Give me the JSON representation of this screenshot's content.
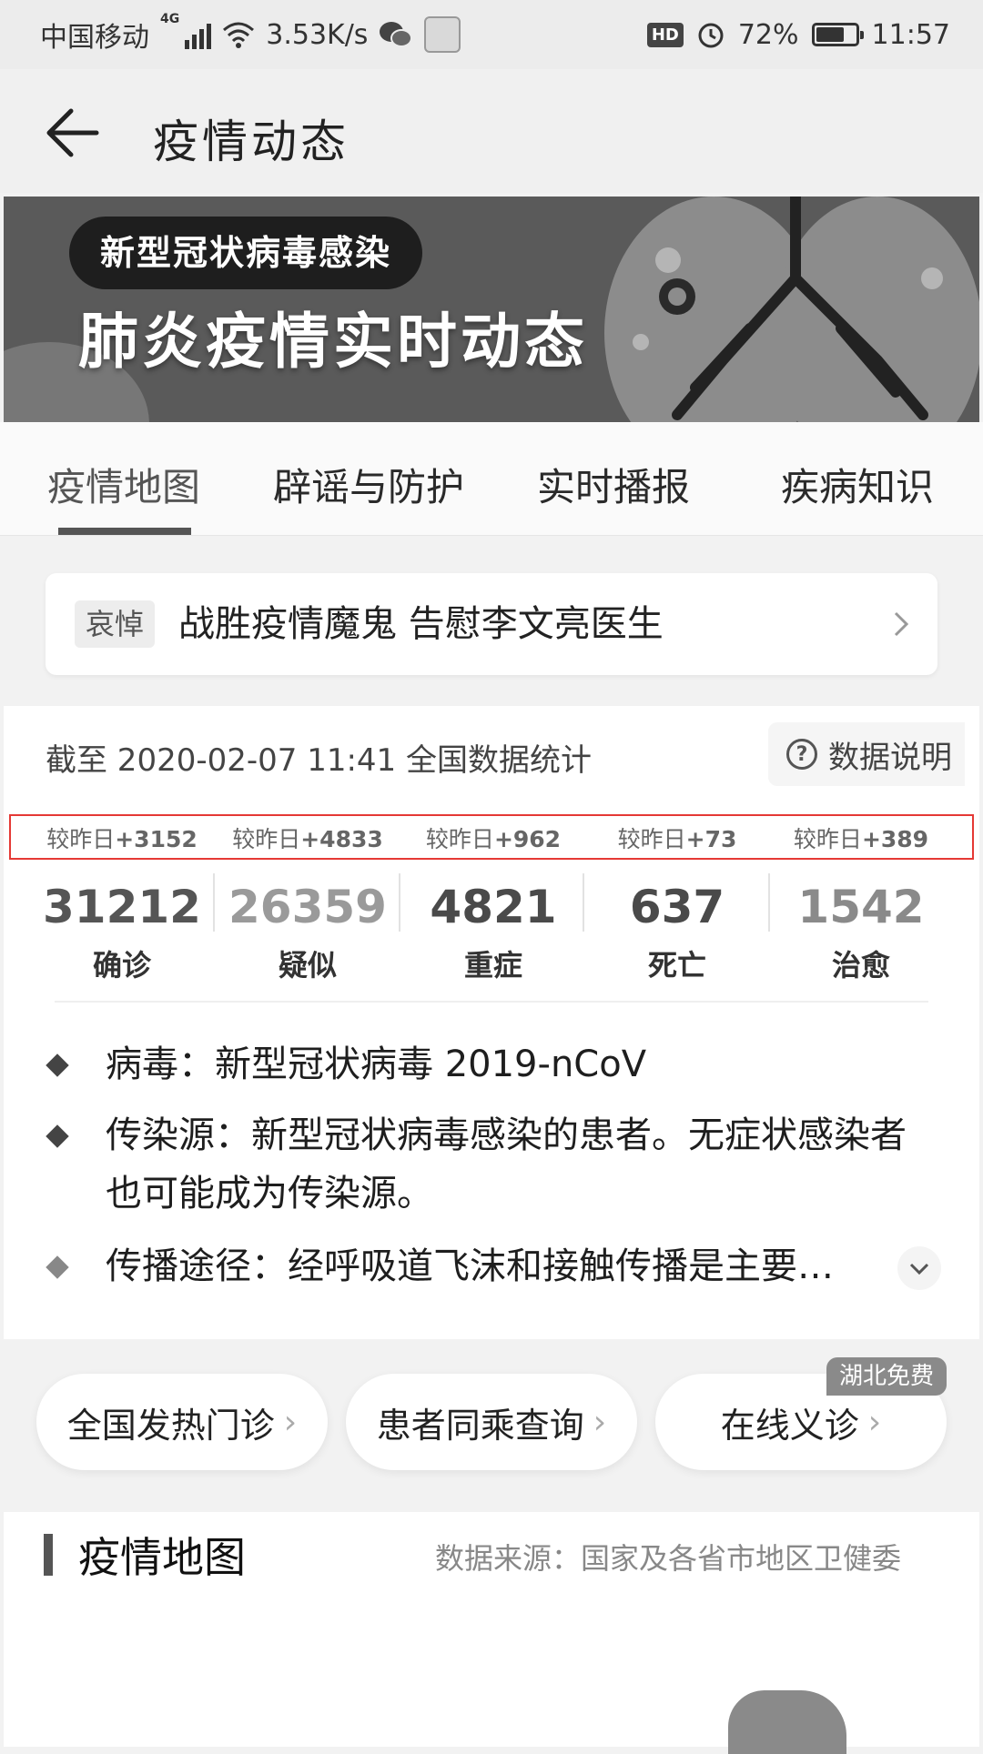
{
  "status_bar": {
    "carrier": "中国移动",
    "net_type": "4G",
    "speed": "3.53K/s",
    "hd_label": "HD",
    "battery": "72%",
    "battery_level": 0.72,
    "time": "11:57",
    "icons": [
      "signal-icon",
      "wifi-icon",
      "wechat-icon",
      "app-icon",
      "alarm-icon",
      "battery-icon"
    ]
  },
  "header": {
    "title": "疫情动态"
  },
  "banner": {
    "pill": "新型冠状病毒感染",
    "title": "肺炎疫情实时动态"
  },
  "tabs": [
    {
      "label": "疫情地图",
      "active": true
    },
    {
      "label": "辟谣与防护",
      "active": false
    },
    {
      "label": "实时播报",
      "active": false
    },
    {
      "label": "疾病知识",
      "active": false
    }
  ],
  "notice": {
    "tag": "哀悼",
    "text": "战胜疫情魔鬼 告慰李文亮医生"
  },
  "summary": {
    "updated": "截至 2020-02-07 11:41 全国数据统计",
    "data_note": "数据说明",
    "delta_prefix": "较昨日",
    "stats": [
      {
        "label": "确诊",
        "value": "31212",
        "delta": "+3152",
        "color": "#555555"
      },
      {
        "label": "疑似",
        "value": "26359",
        "delta": "+4833",
        "color": "#9a9a9a"
      },
      {
        "label": "重症",
        "value": "4821",
        "delta": "+962",
        "color": "#4a4a4a"
      },
      {
        "label": "死亡",
        "value": "637",
        "delta": "+73",
        "color": "#4a4a4a"
      },
      {
        "label": "治愈",
        "value": "1542",
        "delta": "+389",
        "color": "#8a8a8a"
      }
    ]
  },
  "info": [
    {
      "text": "病毒：新型冠状病毒 2019-nCoV"
    },
    {
      "text": "传染源：新型冠状病毒感染的患者。无症状感染者也可能成为传染源。"
    },
    {
      "text": "传播途径：经呼吸道飞沫和接触传播是主要…"
    }
  ],
  "quick_links": [
    {
      "label": "全国发热门诊"
    },
    {
      "label": "患者同乘查询"
    },
    {
      "label": "在线义诊",
      "badge": "湖北免费"
    }
  ],
  "section": {
    "title": "疫情地图",
    "source": "数据来源：国家及各省市地区卫健委"
  },
  "colors": {
    "highlight": "#e53935",
    "accent": "#555555"
  }
}
